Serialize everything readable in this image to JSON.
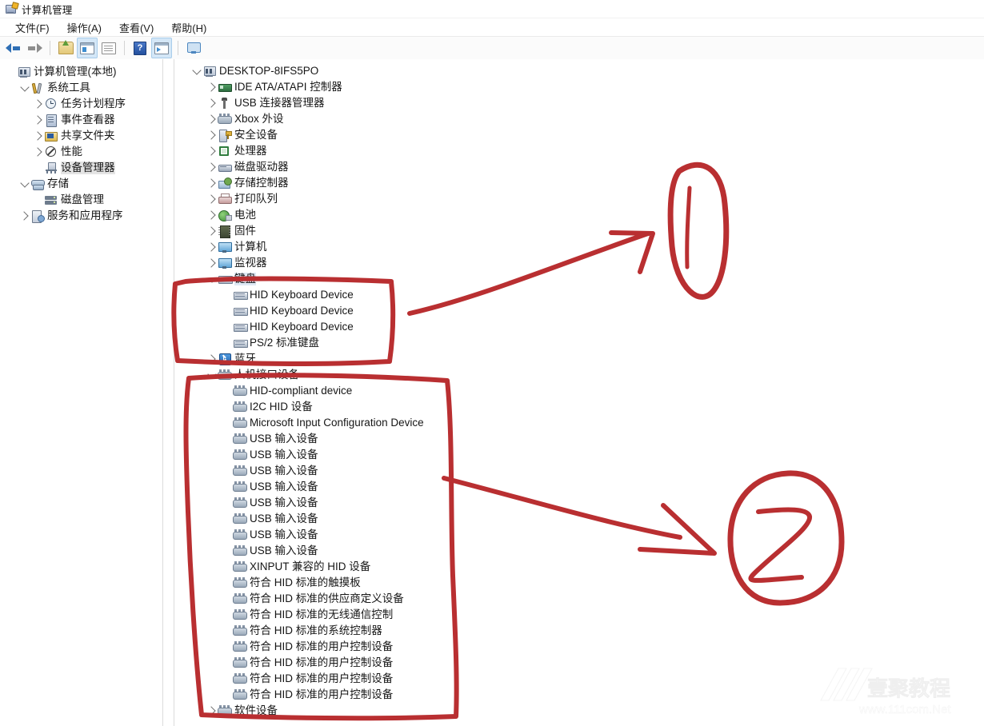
{
  "window": {
    "title": "计算机管理",
    "title_icon": "mmc-console-icon"
  },
  "menu": {
    "items": [
      {
        "label": "文件(F)",
        "name": "menu-file"
      },
      {
        "label": "操作(A)",
        "name": "menu-action"
      },
      {
        "label": "查看(V)",
        "name": "menu-view"
      },
      {
        "label": "帮助(H)",
        "name": "menu-help"
      }
    ]
  },
  "toolbar": {
    "buttons": [
      {
        "name": "back-button",
        "icon": "back-arrow-icon",
        "tooltip": "后退"
      },
      {
        "name": "forward-button",
        "icon": "forward-arrow-icon",
        "tooltip": "前进"
      },
      {
        "name": "up-one-level-button",
        "icon": "folder-up-icon",
        "tooltip": "上移一级"
      },
      {
        "name": "show-hide-console-tree-button",
        "icon": "console-tree-icon",
        "tooltip": "显示/隐藏控制台树"
      },
      {
        "name": "properties-button",
        "icon": "properties-icon",
        "tooltip": "属性"
      },
      {
        "name": "help-button",
        "icon": "help-icon",
        "tooltip": "帮助"
      },
      {
        "name": "action-pane-button",
        "icon": "action-pane-icon",
        "tooltip": "操作窗格"
      },
      {
        "name": "remote-connect-button",
        "icon": "monitor-icon",
        "tooltip": "连接到另一台计算机"
      }
    ]
  },
  "console_tree": {
    "items": [
      {
        "label": "计算机管理(本地)",
        "indent": 0,
        "expander": "none",
        "icon": "computer-management-icon",
        "selected": false
      },
      {
        "label": "系统工具",
        "indent": 1,
        "expander": "down",
        "icon": "system-tools-icon",
        "selected": false
      },
      {
        "label": "任务计划程序",
        "indent": 2,
        "expander": "right",
        "icon": "task-scheduler-clock-icon",
        "selected": false
      },
      {
        "label": "事件查看器",
        "indent": 2,
        "expander": "right",
        "icon": "event-viewer-icon",
        "selected": false
      },
      {
        "label": "共享文件夹",
        "indent": 2,
        "expander": "right",
        "icon": "shared-folder-icon",
        "selected": false
      },
      {
        "label": "性能",
        "indent": 2,
        "expander": "right",
        "icon": "performance-icon",
        "selected": false
      },
      {
        "label": "设备管理器",
        "indent": 2,
        "expander": "none",
        "icon": "device-manager-icon",
        "selected": true
      },
      {
        "label": "存储",
        "indent": 1,
        "expander": "down",
        "icon": "storage-icon",
        "selected": false
      },
      {
        "label": "磁盘管理",
        "indent": 2,
        "expander": "none",
        "icon": "disk-management-icon",
        "selected": false
      },
      {
        "label": "服务和应用程序",
        "indent": 1,
        "expander": "right",
        "icon": "services-and-applications-icon",
        "selected": false
      }
    ]
  },
  "device_tree": {
    "items": [
      {
        "label": "DESKTOP-8IFS5PO",
        "indent": 0,
        "expander": "down",
        "icon": "computer-icon",
        "selected": false
      },
      {
        "label": "IDE ATA/ATAPI 控制器",
        "indent": 1,
        "expander": "right",
        "icon": "ide-controller-icon",
        "selected": false
      },
      {
        "label": "USB 连接器管理器",
        "indent": 1,
        "expander": "right",
        "icon": "usb-connector-icon",
        "selected": false
      },
      {
        "label": "Xbox 外设",
        "indent": 1,
        "expander": "right",
        "icon": "hid-device-icon",
        "selected": false
      },
      {
        "label": "安全设备",
        "indent": 1,
        "expander": "right",
        "icon": "security-device-icon",
        "selected": false
      },
      {
        "label": "处理器",
        "indent": 1,
        "expander": "right",
        "icon": "processor-icon",
        "selected": false
      },
      {
        "label": "磁盘驱动器",
        "indent": 1,
        "expander": "right",
        "icon": "disk-drive-icon",
        "selected": false
      },
      {
        "label": "存储控制器",
        "indent": 1,
        "expander": "right",
        "icon": "storage-controller-icon",
        "selected": false
      },
      {
        "label": "打印队列",
        "indent": 1,
        "expander": "right",
        "icon": "print-queue-icon",
        "selected": false
      },
      {
        "label": "电池",
        "indent": 1,
        "expander": "right",
        "icon": "battery-icon",
        "selected": false
      },
      {
        "label": "固件",
        "indent": 1,
        "expander": "right",
        "icon": "firmware-icon",
        "selected": false
      },
      {
        "label": "计算机",
        "indent": 1,
        "expander": "right",
        "icon": "monitor-icon",
        "selected": false
      },
      {
        "label": "监视器",
        "indent": 1,
        "expander": "right",
        "icon": "monitor-icon",
        "selected": false
      },
      {
        "label": "键盘",
        "indent": 1,
        "expander": "down",
        "icon": "keyboard-icon",
        "selected": true
      },
      {
        "label": "HID Keyboard Device",
        "indent": 2,
        "expander": "none",
        "icon": "keyboard-icon",
        "selected": false
      },
      {
        "label": "HID Keyboard Device",
        "indent": 2,
        "expander": "none",
        "icon": "keyboard-icon",
        "selected": false
      },
      {
        "label": "HID Keyboard Device",
        "indent": 2,
        "expander": "none",
        "icon": "keyboard-icon",
        "selected": false
      },
      {
        "label": "PS/2 标准键盘",
        "indent": 2,
        "expander": "none",
        "icon": "keyboard-icon",
        "selected": false
      },
      {
        "label": "蓝牙",
        "indent": 1,
        "expander": "right",
        "icon": "bluetooth-icon",
        "selected": false
      },
      {
        "label": "人机接口设备",
        "indent": 1,
        "expander": "down",
        "icon": "hid-device-icon",
        "selected": false
      },
      {
        "label": "HID-compliant device",
        "indent": 2,
        "expander": "none",
        "icon": "hid-device-icon",
        "selected": false
      },
      {
        "label": "I2C HID 设备",
        "indent": 2,
        "expander": "none",
        "icon": "hid-device-icon",
        "selected": false
      },
      {
        "label": "Microsoft Input Configuration Device",
        "indent": 2,
        "expander": "none",
        "icon": "hid-device-icon",
        "selected": false
      },
      {
        "label": "USB 输入设备",
        "indent": 2,
        "expander": "none",
        "icon": "hid-device-icon",
        "selected": false
      },
      {
        "label": "USB 输入设备",
        "indent": 2,
        "expander": "none",
        "icon": "hid-device-icon",
        "selected": false
      },
      {
        "label": "USB 输入设备",
        "indent": 2,
        "expander": "none",
        "icon": "hid-device-icon",
        "selected": false
      },
      {
        "label": "USB 输入设备",
        "indent": 2,
        "expander": "none",
        "icon": "hid-device-icon",
        "selected": false
      },
      {
        "label": "USB 输入设备",
        "indent": 2,
        "expander": "none",
        "icon": "hid-device-icon",
        "selected": false
      },
      {
        "label": "USB 输入设备",
        "indent": 2,
        "expander": "none",
        "icon": "hid-device-icon",
        "selected": false
      },
      {
        "label": "USB 输入设备",
        "indent": 2,
        "expander": "none",
        "icon": "hid-device-icon",
        "selected": false
      },
      {
        "label": "USB 输入设备",
        "indent": 2,
        "expander": "none",
        "icon": "hid-device-icon",
        "selected": false
      },
      {
        "label": "XINPUT 兼容的 HID 设备",
        "indent": 2,
        "expander": "none",
        "icon": "hid-device-icon",
        "selected": false
      },
      {
        "label": "符合 HID 标准的触摸板",
        "indent": 2,
        "expander": "none",
        "icon": "hid-device-icon",
        "selected": false
      },
      {
        "label": "符合 HID 标准的供应商定义设备",
        "indent": 2,
        "expander": "none",
        "icon": "hid-device-icon",
        "selected": false
      },
      {
        "label": "符合 HID 标准的无线通信控制",
        "indent": 2,
        "expander": "none",
        "icon": "hid-device-icon",
        "selected": false
      },
      {
        "label": "符合 HID 标准的系统控制器",
        "indent": 2,
        "expander": "none",
        "icon": "hid-device-icon",
        "selected": false
      },
      {
        "label": "符合 HID 标准的用户控制设备",
        "indent": 2,
        "expander": "none",
        "icon": "hid-device-icon",
        "selected": false
      },
      {
        "label": "符合 HID 标准的用户控制设备",
        "indent": 2,
        "expander": "none",
        "icon": "hid-device-icon",
        "selected": false
      },
      {
        "label": "符合 HID 标准的用户控制设备",
        "indent": 2,
        "expander": "none",
        "icon": "hid-device-icon",
        "selected": false
      },
      {
        "label": "符合 HID 标准的用户控制设备",
        "indent": 2,
        "expander": "none",
        "icon": "hid-device-icon",
        "selected": false
      },
      {
        "label": "软件设备",
        "indent": 1,
        "expander": "right",
        "icon": "hid-device-icon",
        "selected": false
      }
    ]
  },
  "annotations": {
    "color": "#b92f31",
    "marks": [
      {
        "name": "annotation-box-keyboard",
        "shape": "hand-drawn-rectangle",
        "target": "键盘"
      },
      {
        "name": "annotation-box-hid",
        "shape": "hand-drawn-rectangle",
        "target": "人机接口设备"
      },
      {
        "name": "annotation-arrow-1",
        "shape": "arrow",
        "points_to": "annotation-number-1"
      },
      {
        "name": "annotation-arrow-2",
        "shape": "arrow",
        "points_to": "annotation-number-2"
      },
      {
        "name": "annotation-number-1",
        "shape": "circled-number",
        "label": "1"
      },
      {
        "name": "annotation-number-2",
        "shape": "circled-number",
        "label": "2"
      }
    ]
  },
  "watermark": {
    "brand": "壹聚教程",
    "url": "www.111com.Net"
  }
}
